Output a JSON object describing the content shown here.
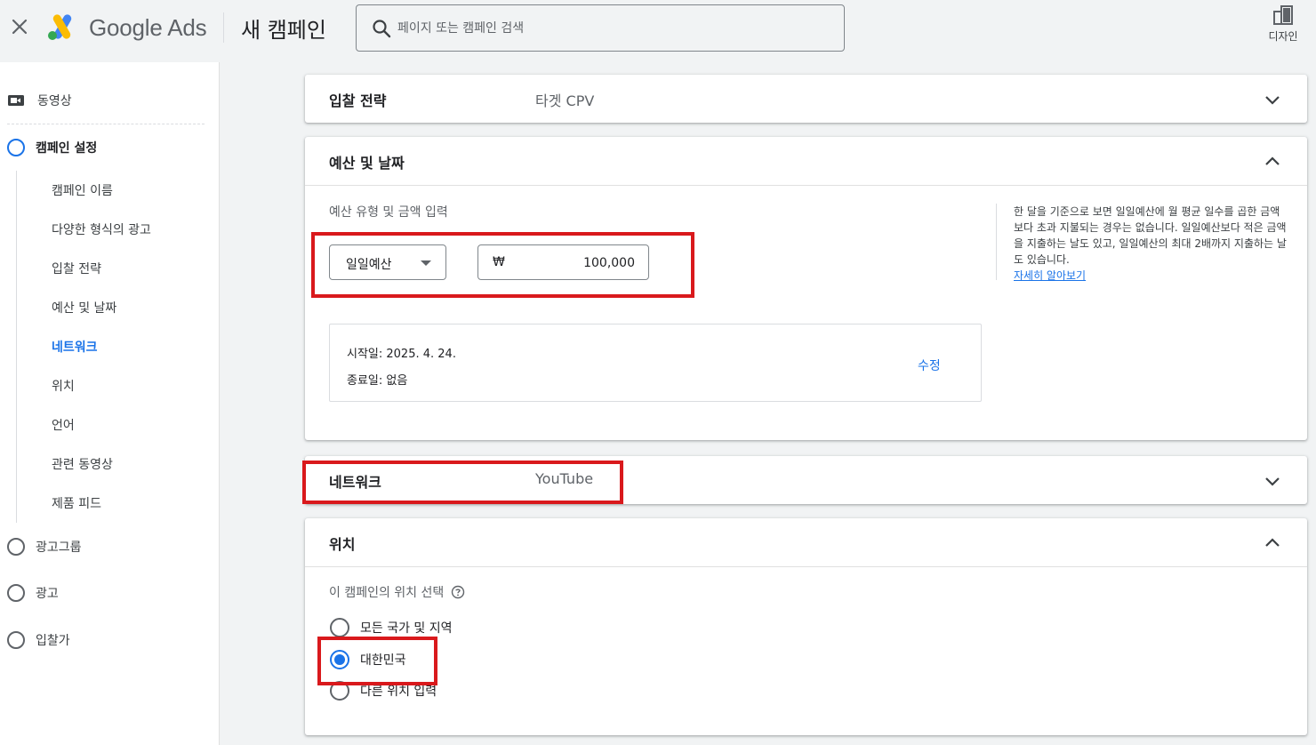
{
  "header": {
    "brand": "Google Ads",
    "page_title": "새 캠페인",
    "search_placeholder": "페이지 또는 캠페인 검색",
    "design_label": "디자인"
  },
  "sidebar": {
    "top_item": "동영상",
    "steps": {
      "campaign_settings": "캠페인 설정",
      "ad_group": "광고그룹",
      "ad": "광고",
      "bidding": "입찰가"
    },
    "sub_items": [
      "캠페인 이름",
      "다양한 형식의 광고",
      "입찰 전략",
      "예산 및 날짜",
      "네트워크",
      "위치",
      "언어",
      "관련 동영상",
      "제품 피드"
    ],
    "active_sub_item": "네트워크"
  },
  "sections": {
    "bidding": {
      "title": "입찰 전략",
      "summary": "타겟 CPV"
    },
    "budget": {
      "title": "예산 및 날짜",
      "label": "예산 유형 및 금액 입력",
      "type": "일일예산",
      "currency": "₩",
      "amount": "100,000",
      "info": "한 달을 기준으로 보면 일일예산에 월 평균 일수를 곱한 금액보다 초과 지불되는 경우는 없습니다. 일일예산보다 적은 금액을 지출하는 날도 있고, 일일예산의 최대 2배까지 지출하는 날도 있습니다.",
      "info_link": "자세히 알아보기",
      "start_date": "시작일: 2025. 4. 24.",
      "end_date": "종료일: 없음",
      "edit": "수정"
    },
    "network": {
      "title": "네트워크",
      "summary": "YouTube"
    },
    "location": {
      "title": "위치",
      "label": "이 캠페인의 위치 선택",
      "options": [
        "모든 국가 및 지역",
        "대한민국",
        "다른 위치 입력"
      ],
      "selected": "대한민국"
    }
  },
  "colors": {
    "accent": "#1a73e8",
    "highlight": "#d9191c",
    "background": "#f1f3f4"
  }
}
